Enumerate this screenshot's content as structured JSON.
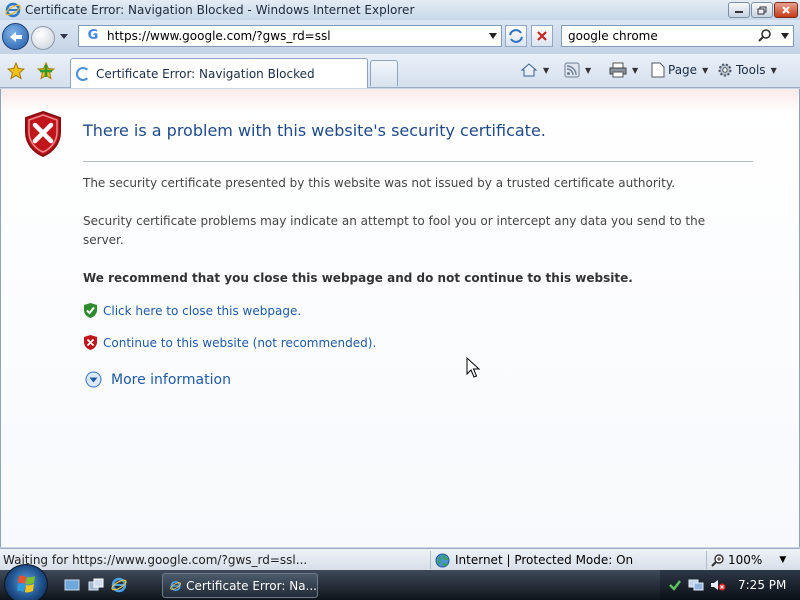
{
  "window": {
    "title": "Certificate Error: Navigation Blocked - Windows Internet Explorer"
  },
  "address_bar": {
    "url": "https://www.google.com/?gws_rd=ssl"
  },
  "search_box": {
    "value": "google chrome"
  },
  "tab": {
    "label": "Certificate Error: Navigation Blocked"
  },
  "commands": {
    "page_label": "Page",
    "tools_label": "Tools"
  },
  "page": {
    "heading": "There is a problem with this website's security certificate.",
    "paragraph1": "The security certificate presented by this website was not issued by a trusted certificate authority.",
    "paragraph2": "Security certificate problems may indicate an attempt to fool you or intercept any data you send to the server.",
    "recommendation": "We recommend that you close this webpage and do not continue to this website.",
    "close_link": "Click here to close this webpage.",
    "continue_link": "Continue to this website (not recommended).",
    "more_info_link": "More information"
  },
  "status_bar": {
    "status_text": "Waiting for https://www.google.com/?gws_rd=ssl...",
    "zone_text": "Internet | Protected Mode: On",
    "zoom_text": "100%"
  },
  "taskbar": {
    "task_label": "Certificate Error: Na...",
    "clock": "7:25 PM"
  },
  "colors": {
    "link": "#1f5aa6",
    "heading": "#1f4a8a",
    "error_red": "#c0161b",
    "ok_green": "#2e8b2e"
  },
  "icons": [
    "ie-icon",
    "back-arrow-icon",
    "forward-arrow-icon",
    "google-g-icon",
    "refresh-icon",
    "stop-icon",
    "search-icon",
    "favorites-star-icon",
    "add-favorites-icon",
    "home-icon",
    "feeds-icon",
    "print-icon",
    "page-icon",
    "tools-gear-icon",
    "error-shield-icon",
    "green-shield-icon",
    "red-shield-icon",
    "expand-circle-icon",
    "globe-icon",
    "zoom-icon",
    "windows-start-icon",
    "mouse-cursor-icon"
  ]
}
